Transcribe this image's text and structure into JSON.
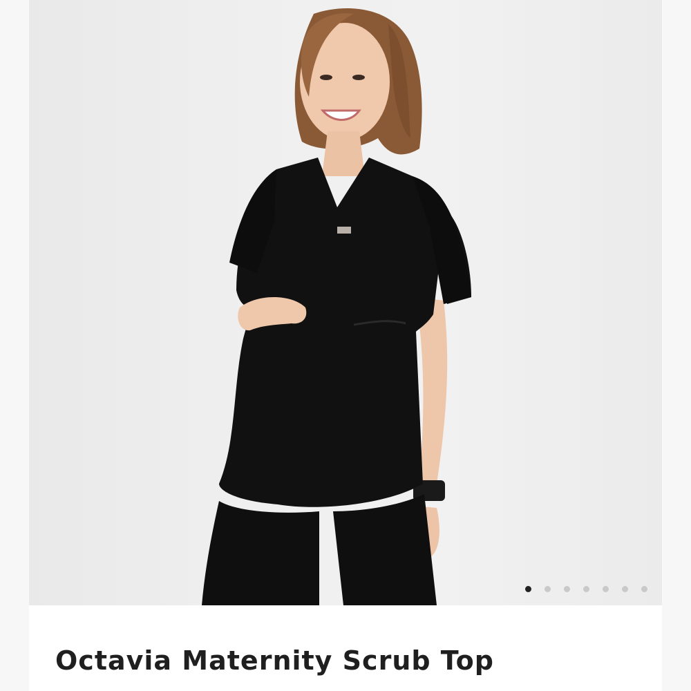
{
  "product": {
    "title": "Octavia Maternity Scrub Top",
    "image_description": "",
    "garment_color": "#111111",
    "background_color": "#efefef"
  },
  "carousel": {
    "total_images": 7,
    "active_index": 0
  }
}
